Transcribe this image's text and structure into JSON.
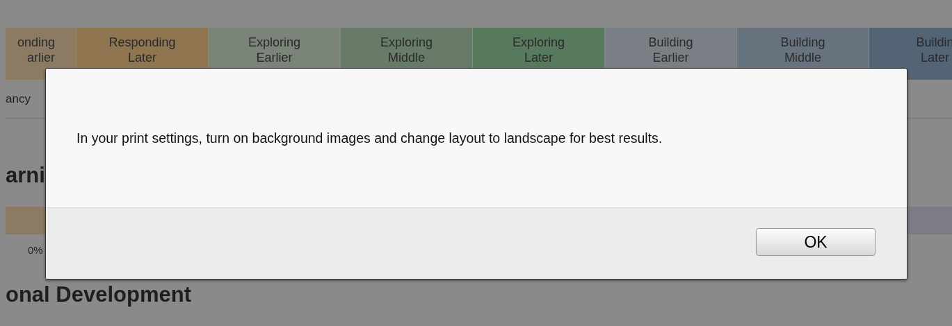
{
  "stage_headers": [
    {
      "lines": [
        "onding",
        "arlier"
      ],
      "color": "#8b7b62"
    },
    {
      "lines": [
        "Responding",
        "Later"
      ],
      "color": "#8f7650"
    },
    {
      "lines": [
        "Exploring",
        "Earlier"
      ],
      "color": "#7a8479"
    },
    {
      "lines": [
        "Exploring",
        "Middle"
      ],
      "color": "#677b68"
    },
    {
      "lines": [
        "Exploring",
        "Later"
      ],
      "color": "#577a5c"
    },
    {
      "lines": [
        "Building",
        "Earlier"
      ],
      "color": "#7a7f86"
    },
    {
      "lines": [
        "Building",
        "Middle"
      ],
      "color": "#677480"
    },
    {
      "lines": [
        "Buildin",
        "Later"
      ],
      "color": "#536474"
    }
  ],
  "row_label": "ancy",
  "section_title": "arni",
  "distribution_bar": [
    {
      "color": "#8b7b62"
    },
    {
      "color": "#7e7a86"
    }
  ],
  "readings": [
    "0%"
  ],
  "next_section_title": "onal Development",
  "dialog": {
    "message": "In your print settings, turn on background images and change layout to landscape for best results.",
    "buttons": [
      "OK"
    ]
  }
}
